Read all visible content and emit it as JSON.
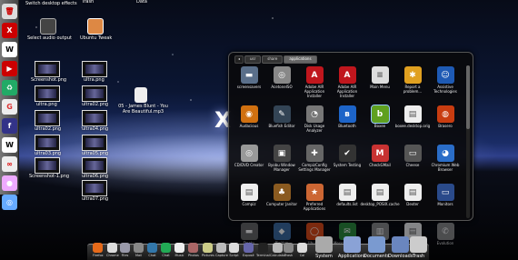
{
  "desktop": {
    "top_labels": [
      "Switch desktop effects",
      "Trash",
      "Data"
    ],
    "audio": "Select audio output",
    "tweak": "Ubuntu Tweak",
    "files_col1": [
      "Screenshot.png",
      "ultra.png",
      "ultra02.png",
      "ultra03.png",
      "Screenshot-1.png"
    ],
    "files_col2": [
      "ultra.png",
      "ultra02.png",
      "ultra04.png",
      "ultra05.png",
      "ultra06.png",
      "ultra07.png"
    ],
    "mp3": "05 - James Blunt - You Are Beautiful.mp3",
    "logo_letter": "X"
  },
  "window": {
    "crumbs": [
      "usr",
      "share",
      "applications"
    ],
    "apps": [
      {
        "label": "screensavers",
        "icon": "folder-icon",
        "color": "#5a6f8a",
        "glyph": "▬"
      },
      {
        "label": "AcetoneISO",
        "icon": "disc-icon",
        "color": "#888",
        "glyph": "◎"
      },
      {
        "label": "Adobe AIR Application Installer",
        "icon": "adobe-air-icon",
        "color": "#c0161d",
        "glyph": "A"
      },
      {
        "label": "Adobe AIR Application Installer",
        "icon": "adobe-air-icon",
        "color": "#c0161d",
        "glyph": "A"
      },
      {
        "label": "Main Menu",
        "icon": "menu-icon",
        "color": "#ddd",
        "glyph": "≡"
      },
      {
        "label": "Report a problem...",
        "icon": "report-icon",
        "color": "#e0a020",
        "glyph": "✱"
      },
      {
        "label": "Assistive Technologies",
        "icon": "accessibility-icon",
        "color": "#1e5ab4",
        "glyph": "☺"
      },
      {
        "label": "Audacious",
        "icon": "audacious-icon",
        "color": "#d07010",
        "glyph": "◉"
      },
      {
        "label": "Bluefish Editor",
        "icon": "bluefish-icon",
        "color": "#345",
        "glyph": "✎"
      },
      {
        "label": "Disk Usage Analyzer",
        "icon": "disk-usage-icon",
        "color": "#777",
        "glyph": "◔"
      },
      {
        "label": "Bluetooth",
        "icon": "bluetooth-icon",
        "color": "#1d64c8",
        "glyph": "ʙ"
      },
      {
        "label": "Boxee",
        "icon": "boxee-icon",
        "color": "#5fa020",
        "glyph": "b"
      },
      {
        "label": "boxee.desktop.orig",
        "icon": "document-icon",
        "color": "#eee",
        "glyph": "▤"
      },
      {
        "label": "Brasero",
        "icon": "brasero-icon",
        "color": "#c83c10",
        "glyph": "◍"
      },
      {
        "label": "CD/DVD Creator",
        "icon": "cd-icon",
        "color": "#999",
        "glyph": "◎"
      },
      {
        "label": "Byobu Window Manager",
        "icon": "byobu-icon",
        "color": "#444",
        "glyph": "▣"
      },
      {
        "label": "CompizConfig Settings Manager",
        "icon": "compiz-icon",
        "color": "#666",
        "glyph": "✚"
      },
      {
        "label": "System Testing",
        "icon": "testing-icon",
        "color": "#333",
        "glyph": "✔"
      },
      {
        "label": "CheckGMail",
        "icon": "gmail-icon",
        "color": "#c83232",
        "glyph": "M"
      },
      {
        "label": "Cheese",
        "icon": "cheese-icon",
        "color": "#555",
        "glyph": "▭"
      },
      {
        "label": "Chromium Web Browser",
        "icon": "chromium-icon",
        "color": "#2a6dc8",
        "glyph": "◕"
      },
      {
        "label": "Compiz",
        "icon": "document-icon",
        "color": "#eee",
        "glyph": "▤"
      },
      {
        "label": "Computer Janitor",
        "icon": "janitor-icon",
        "color": "#8a5a20",
        "glyph": "♣"
      },
      {
        "label": "Preferred Applications",
        "icon": "preferred-apps-icon",
        "color": "#c63",
        "glyph": "★"
      },
      {
        "label": "defaults.list",
        "icon": "document-icon",
        "color": "#eee",
        "glyph": "▤"
      },
      {
        "label": "desktop_POSIX.cache",
        "icon": "document-icon",
        "color": "#eee",
        "glyph": "▤"
      },
      {
        "label": "Dexter",
        "icon": "document-icon",
        "color": "#eee",
        "glyph": "▤"
      },
      {
        "label": "Monitors",
        "icon": "monitor-icon",
        "color": "#2a4a8a",
        "glyph": "▭"
      },
      {
        "label": "Docky",
        "icon": "docky-icon",
        "color": "#666",
        "glyph": "▬"
      },
      {
        "label": "Pinidea",
        "icon": "pinidea-icon",
        "color": "#3a6aa0",
        "glyph": "◆"
      },
      {
        "label": "Ubuntu",
        "icon": "ubuntu-icon",
        "color": "#dd4814",
        "glyph": "◯"
      },
      {
        "label": "Messaging and",
        "icon": "messaging-icon",
        "color": "#2a8a3a",
        "glyph": "✉"
      },
      {
        "label": "Print",
        "icon": "print-icon",
        "color": "#888",
        "glyph": "▥"
      },
      {
        "label": "Document",
        "icon": "document-icon",
        "color": "#eee",
        "glyph": "▤"
      },
      {
        "label": "Evolution",
        "icon": "evolution-icon",
        "color": "#888",
        "glyph": "✆"
      }
    ]
  },
  "bottom_dock": {
    "small": [
      "Firefox",
      "Chrome",
      "Files",
      "Mail",
      "Chat",
      "Chat",
      "Music",
      "Photos",
      "Pictures",
      "Capture",
      "Script",
      "Exposé",
      "Terminal",
      "Calculator",
      "Trash",
      "Cal"
    ],
    "big": [
      "System",
      "Applications",
      "Documents",
      "Downloads",
      "Trash"
    ]
  }
}
